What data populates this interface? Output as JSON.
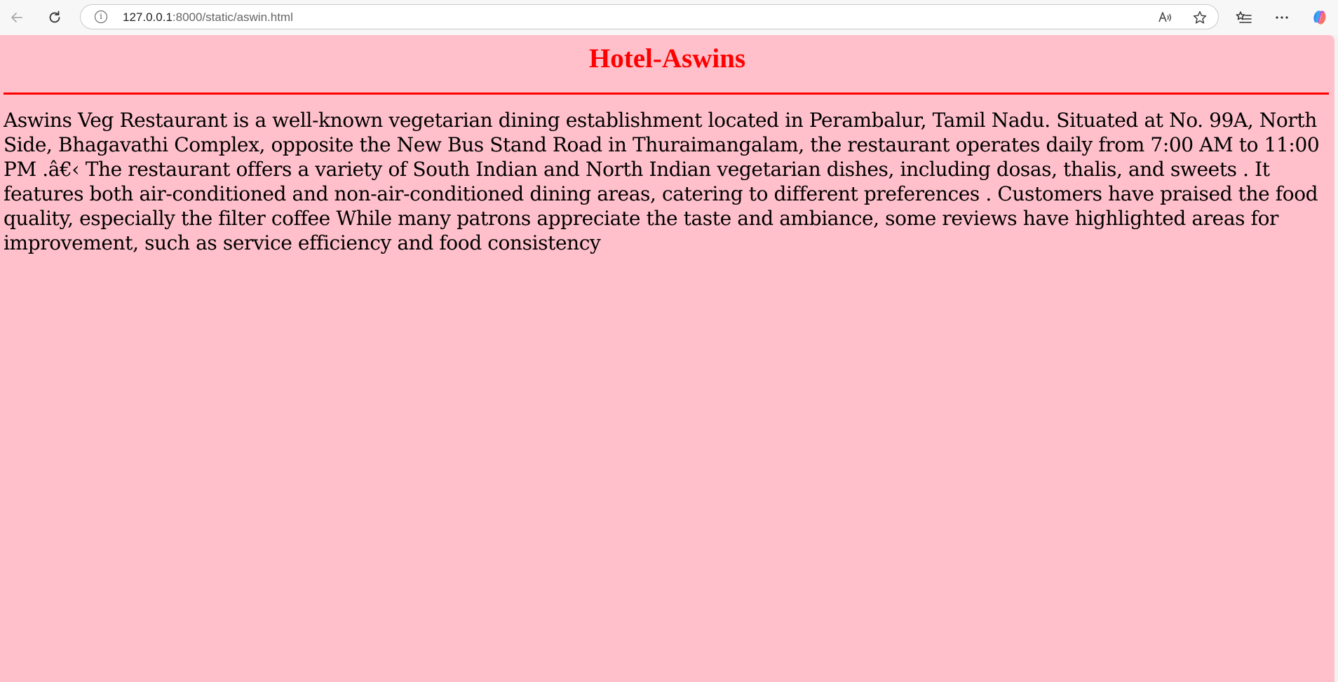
{
  "browser": {
    "url_host": "127.0.0.1",
    "url_rest": ":8000/static/aswin.html",
    "icons": {
      "back": "arrow-left-icon",
      "reload": "reload-icon",
      "info": "info-icon",
      "read_aloud": "read-aloud-icon",
      "favorite": "star-icon",
      "favorites_bar": "favorites-list-icon",
      "more": "more-dots-icon",
      "copilot": "copilot-icon"
    }
  },
  "page": {
    "title": "Hotel-Aswins",
    "title_color": "#ff0000",
    "background_color": "#ffc0cb",
    "description": "Aswins Veg Restaurant is a well-known vegetarian dining establishment located in Perambalur, Tamil Nadu. Situated at No. 99A, North Side, Bhagavathi Complex, opposite the New Bus Stand Road in Thuraimangalam, the restaurant operates daily from 7:00 AM to 11:00 PM .â€‹ The restaurant offers a variety of South Indian and North Indian vegetarian dishes, including dosas, thalis, and sweets . It features both air-conditioned and non-air-conditioned dining areas, catering to different preferences . Customers have praised the food quality, especially the filter coffee While many patrons appreciate the taste and ambiance, some reviews have highlighted areas for improvement, such as service efficiency and food consistency"
  }
}
